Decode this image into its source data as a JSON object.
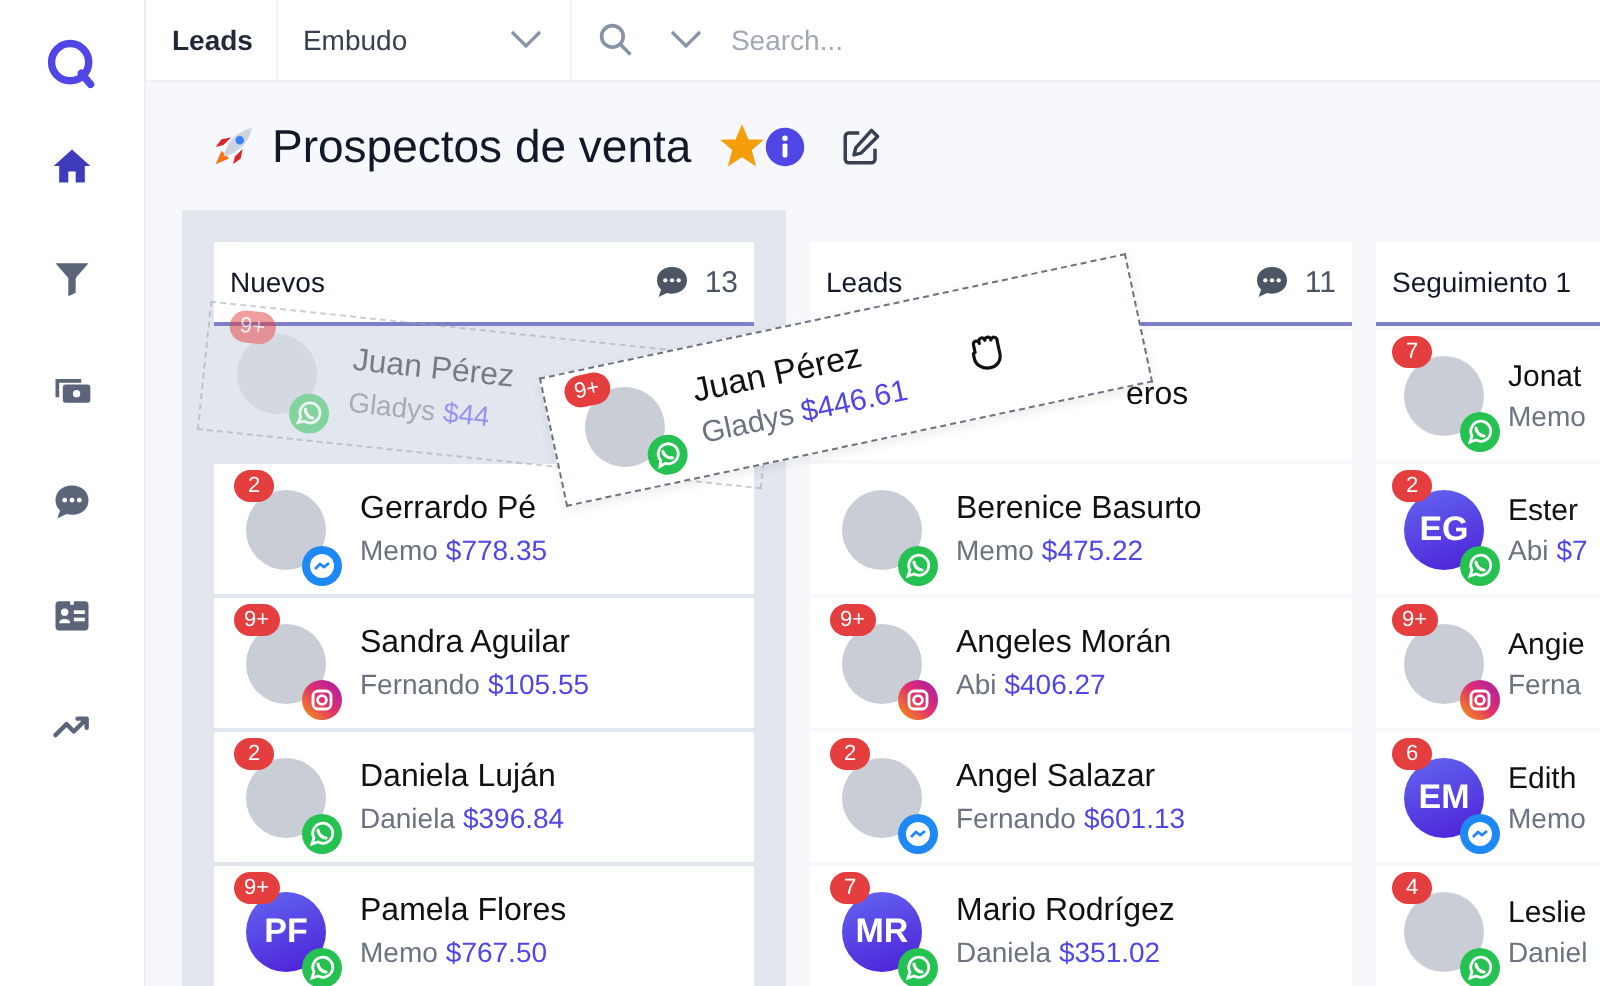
{
  "sidebar": {
    "items": [
      {
        "kind": "home",
        "selected": true
      },
      {
        "kind": "funnel",
        "selected": false
      },
      {
        "kind": "money",
        "selected": false
      },
      {
        "kind": "chat",
        "selected": false
      },
      {
        "kind": "contact",
        "selected": false
      },
      {
        "kind": "trend",
        "selected": false
      }
    ]
  },
  "top_bar": {
    "module": "Leads",
    "pipeline_select": {
      "value": "Embudo"
    },
    "search": {
      "placeholder": "Search..."
    }
  },
  "page_title": {
    "text": "Prospectos de venta",
    "starred": true
  },
  "columns": [
    {
      "title": "Nuevos",
      "count": "13",
      "drop_target": true,
      "cards": [
        {
          "kind": "ghost",
          "badge": "9+",
          "avatar": {
            "kind": "photo"
          },
          "channel": {
            "kind": "whatsapp"
          },
          "name": "Juan Pérez",
          "owner": "Gladys",
          "amount": "$44"
        },
        {
          "kind": "card",
          "badge": "2",
          "avatar": {
            "kind": "photo"
          },
          "channel": {
            "kind": "messenger"
          },
          "name": "Gerrardo Pé",
          "owner": "Memo",
          "amount": "$778.35"
        },
        {
          "kind": "card",
          "badge": "9+",
          "avatar": {
            "kind": "photo"
          },
          "channel": {
            "kind": "instagram"
          },
          "name": "Sandra Aguilar",
          "owner": "Fernando",
          "amount": "$105.55"
        },
        {
          "kind": "card",
          "badge": "2",
          "avatar": {
            "kind": "photo"
          },
          "channel": {
            "kind": "whatsapp"
          },
          "name": "Daniela Luján",
          "owner": "Daniela",
          "amount": "$396.84"
        },
        {
          "kind": "card",
          "badge": "9+",
          "avatar": {
            "kind": "initials",
            "initials": "PF"
          },
          "channel": {
            "kind": "whatsapp"
          },
          "name": "Pamela Flores",
          "owner": "Memo",
          "amount": "$767.50"
        }
      ]
    },
    {
      "title": "Leads",
      "count": "11",
      "drop_target": false,
      "cards": [
        {
          "kind": "covered",
          "name": "eros"
        },
        {
          "kind": "card",
          "avatar": {
            "kind": "photo"
          },
          "channel": {
            "kind": "whatsapp"
          },
          "name": "Berenice Basurto",
          "owner": "Memo",
          "amount": "$475.22"
        },
        {
          "kind": "card",
          "badge": "9+",
          "avatar": {
            "kind": "photo"
          },
          "channel": {
            "kind": "instagram"
          },
          "name": "Angeles Morán",
          "owner": "Abi",
          "amount": "$406.27"
        },
        {
          "kind": "card",
          "badge": "2",
          "avatar": {
            "kind": "photo"
          },
          "channel": {
            "kind": "messenger"
          },
          "name": "Angel Salazar",
          "owner": "Fernando",
          "amount": "$601.13"
        },
        {
          "kind": "card",
          "badge": "7",
          "avatar": {
            "kind": "initials",
            "initials": "MR"
          },
          "channel": {
            "kind": "whatsapp"
          },
          "name": "Mario Rodrígez",
          "owner": "Daniela",
          "amount": "$351.02"
        }
      ]
    },
    {
      "title": "Seguimiento 1",
      "drop_target": false,
      "cards": [
        {
          "kind": "card",
          "badge": "7",
          "avatar": {
            "kind": "photo"
          },
          "channel": {
            "kind": "whatsapp"
          },
          "name": "Jonat",
          "owner": "Memo"
        },
        {
          "kind": "card",
          "badge": "2",
          "avatar": {
            "kind": "initials",
            "initials": "EG"
          },
          "channel": {
            "kind": "whatsapp"
          },
          "name": "Ester",
          "owner": "Abi",
          "amount": "$7"
        },
        {
          "kind": "card",
          "badge": "9+",
          "avatar": {
            "kind": "photo"
          },
          "channel": {
            "kind": "instagram"
          },
          "name": "Angie",
          "owner": "Ferna"
        },
        {
          "kind": "card",
          "badge": "6",
          "avatar": {
            "kind": "initials",
            "initials": "EM"
          },
          "channel": {
            "kind": "messenger"
          },
          "name": "Edith",
          "owner": "Memo"
        },
        {
          "kind": "card",
          "badge": "4",
          "avatar": {
            "kind": "photo"
          },
          "channel": {
            "kind": "whatsapp"
          },
          "name": "Leslie",
          "owner": "Daniel"
        }
      ]
    }
  ],
  "dragged_card": {
    "badge": "9+",
    "avatar": {
      "kind": "photo"
    },
    "channel": {
      "kind": "whatsapp"
    },
    "name": "Juan Pérez",
    "owner": "Gladys",
    "amount": "$446.61"
  }
}
